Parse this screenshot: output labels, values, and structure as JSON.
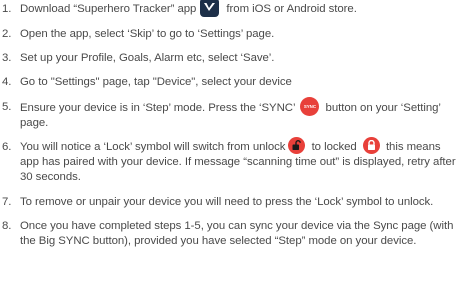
{
  "steps": [
    {
      "num": "1.",
      "before": "Download “Superhero Tracker” app",
      "icon": "superhero-tracker-app-icon",
      "after": "from iOS or Android store."
    },
    {
      "num": "2.",
      "text": "Open the app, select ‘Skip’ to go to ‘Settings’ page."
    },
    {
      "num": "3.",
      "text": "Set up your Profile, Goals, Alarm etc, select ‘Save’."
    },
    {
      "num": "4.",
      "text": "Go to \"Settings\" page, tap \"Device\", select your device"
    },
    {
      "num": "5.",
      "before": "Ensure your device is in ‘Step’ mode. Press the ‘SYNC’",
      "icon_label": "SYNC",
      "after": "button on your ‘Setting’ page."
    },
    {
      "num": "6.",
      "part1": "You will notice a ‘Lock’ symbol will switch from unlock",
      "part2": "to locked",
      "part3": "this means app has paired with your device. If message “scanning time out” is displayed, retry after 30 seconds."
    },
    {
      "num": "7.",
      "text": "To remove or unpair your device you will need to press the ‘Lock’ symbol to unlock."
    },
    {
      "num": "8.",
      "text": "Once you have completed steps 1-5, you can sync your device via the Sync page (with the Big SYNC button), provided you have selected “Step” mode on your device."
    }
  ],
  "colors": {
    "text": "#4a4a4a",
    "accent_red": "#e8403a",
    "app_icon_bg": "#1d2f48"
  }
}
